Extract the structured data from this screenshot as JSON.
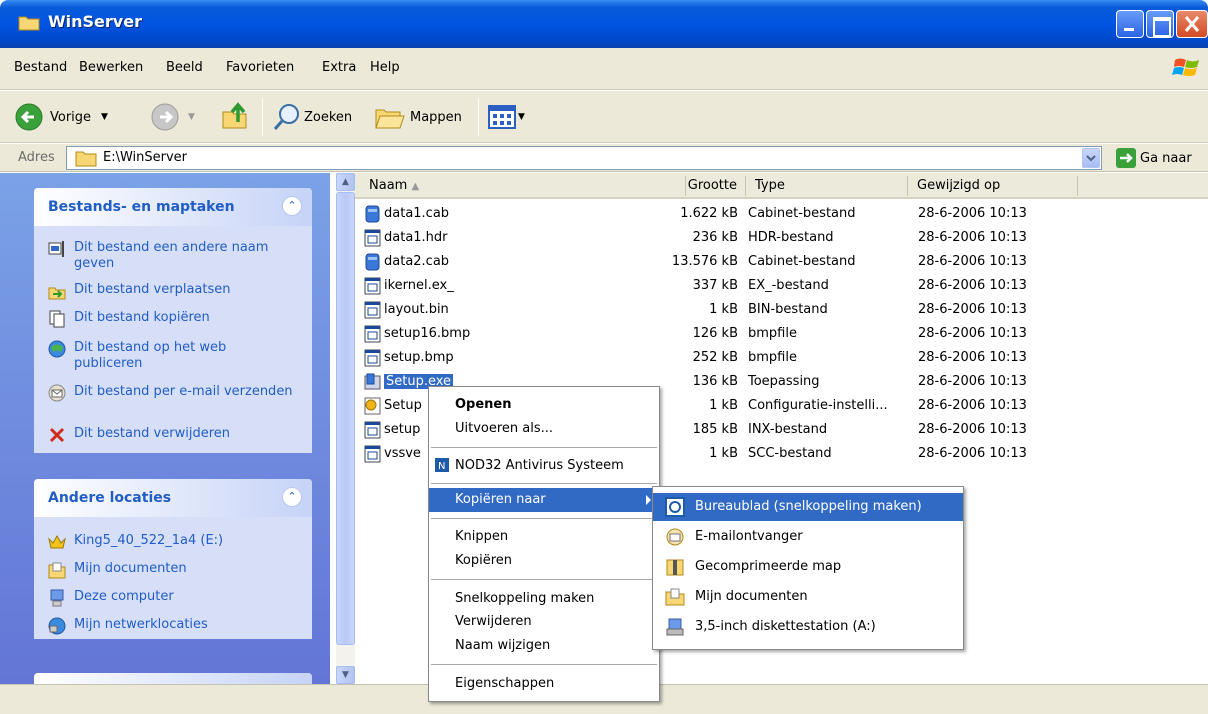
{
  "window": {
    "title": "WinServer"
  },
  "menubar": [
    "Bestand",
    "Bewerken",
    "Beeld",
    "Favorieten",
    "Extra",
    "Help"
  ],
  "toolbar": {
    "back": "Vorige",
    "search": "Zoeken",
    "folders": "Mappen"
  },
  "address": {
    "label": "Adres",
    "path": "E:\\WinServer",
    "go": "Ga naar"
  },
  "tasks_panel": {
    "title": "Bestands- en maptaken",
    "items": [
      {
        "label": "Dit bestand een andere naam geven",
        "icon": "rename-icon"
      },
      {
        "label": "Dit bestand verplaatsen",
        "icon": "move-icon"
      },
      {
        "label": "Dit bestand kopiëren",
        "icon": "copy-icon"
      },
      {
        "label": "Dit bestand op het web publiceren",
        "icon": "web-publish-icon"
      },
      {
        "label": "Dit bestand per e-mail verzenden",
        "icon": "email-icon"
      },
      {
        "label": "Dit bestand verwijderen",
        "icon": "delete-icon"
      }
    ]
  },
  "locations_panel": {
    "title": "Andere locaties",
    "items": [
      {
        "label": "King5_40_522_1a4 (E:)",
        "icon": "drive-icon"
      },
      {
        "label": "Mijn documenten",
        "icon": "my-documents-icon"
      },
      {
        "label": "Deze computer",
        "icon": "computer-icon"
      },
      {
        "label": "Mijn netwerklocaties",
        "icon": "network-icon"
      }
    ]
  },
  "columns": {
    "name": "Naam",
    "size": "Grootte",
    "type": "Type",
    "modified": "Gewijzigd op"
  },
  "files": [
    {
      "name": "data1.cab",
      "size": "1.622 kB",
      "type": "Cabinet-bestand",
      "modified": "28-6-2006 10:13"
    },
    {
      "name": "data1.hdr",
      "size": "236 kB",
      "type": "HDR-bestand",
      "modified": "28-6-2006 10:13"
    },
    {
      "name": "data2.cab",
      "size": "13.576 kB",
      "type": "Cabinet-bestand",
      "modified": "28-6-2006 10:13"
    },
    {
      "name": "ikernel.ex_",
      "size": "337 kB",
      "type": "EX_-bestand",
      "modified": "28-6-2006 10:13"
    },
    {
      "name": "layout.bin",
      "size": "1 kB",
      "type": "BIN-bestand",
      "modified": "28-6-2006 10:13"
    },
    {
      "name": "setup16.bmp",
      "size": "126 kB",
      "type": "bmpfile",
      "modified": "28-6-2006 10:13"
    },
    {
      "name": "setup.bmp",
      "size": "252 kB",
      "type": "bmpfile",
      "modified": "28-6-2006 10:13"
    },
    {
      "name": "Setup.exe",
      "size": "136 kB",
      "type": "Toepassing",
      "modified": "28-6-2006 10:13"
    },
    {
      "name": "Setup",
      "size": "1 kB",
      "type": "Configuratie-instelli...",
      "modified": "28-6-2006 10:13"
    },
    {
      "name": "setup",
      "size": "185 kB",
      "type": "INX-bestand",
      "modified": "28-6-2006 10:13"
    },
    {
      "name": "vssve",
      "size": "1 kB",
      "type": "SCC-bestand",
      "modified": "28-6-2006 10:13"
    }
  ],
  "context_menu": {
    "open": "Openen",
    "run_as": "Uitvoeren als...",
    "antivirus": "NOD32 Antivirus Systeem",
    "send_to": "Kopiëren naar",
    "cut": "Knippen",
    "copy": "Kopiëren",
    "shortcut": "Snelkoppeling maken",
    "delete": "Verwijderen",
    "rename": "Naam wijzigen",
    "properties": "Eigenschappen"
  },
  "submenu": [
    {
      "label": "Bureaublad (snelkoppeling maken)",
      "icon": "desktop-icon"
    },
    {
      "label": "E-mailontvanger",
      "icon": "mail-recipient-icon"
    },
    {
      "label": "Gecomprimeerde map",
      "icon": "zip-folder-icon"
    },
    {
      "label": "Mijn documenten",
      "icon": "my-documents-icon"
    },
    {
      "label": "3,5-inch diskettestation (A:)",
      "icon": "floppy-icon"
    }
  ],
  "colors": {
    "title_blue": "#0054e3",
    "selection": "#316ac5",
    "link_blue": "#215dc6"
  }
}
